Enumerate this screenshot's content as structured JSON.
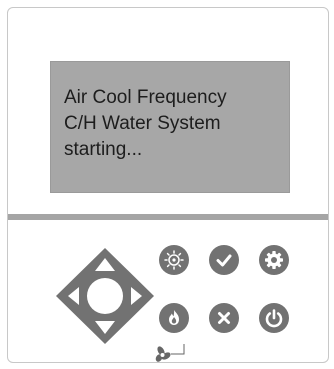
{
  "display": {
    "lines": [
      "Air Cool Frequency",
      "C/H Water System",
      "starting..."
    ]
  },
  "controls": {
    "dpad": [
      "up",
      "down",
      "left",
      "right"
    ],
    "buttons": [
      "mode-button",
      "confirm-button",
      "settings-button",
      "heat-button",
      "cancel-button",
      "power-button"
    ]
  },
  "colors": {
    "screen": "#a7a7a7",
    "button": "#727272",
    "divider": "#a5a5a5"
  }
}
